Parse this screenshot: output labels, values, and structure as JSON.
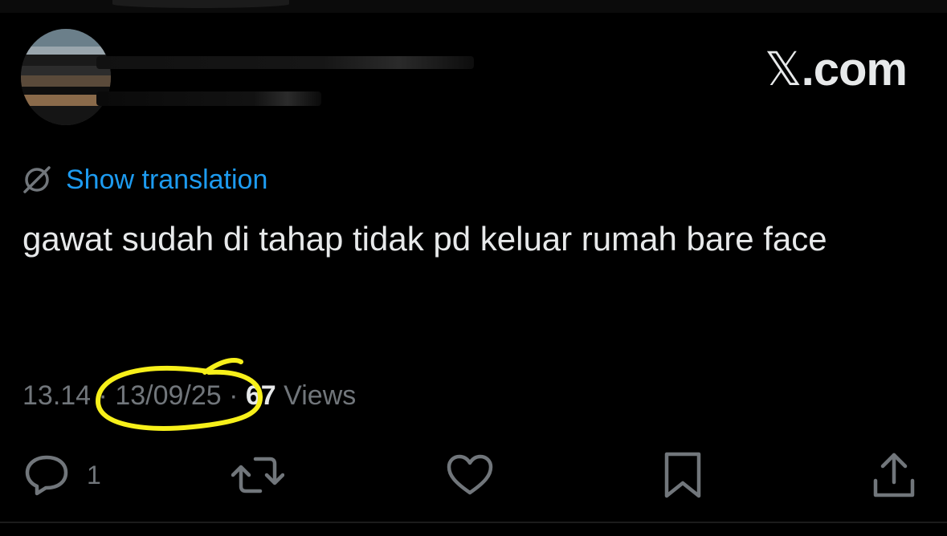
{
  "brand": {
    "logo_text": ".com",
    "logo_x": "𝕏"
  },
  "tweet": {
    "translate_label": "Show translation",
    "text": "gawat sudah di tahap tidak pd keluar rumah bare face",
    "time": "13.14",
    "separator": " · ",
    "date": "13/09/25",
    "views_count": "67",
    "views_label": " Views"
  },
  "actions": {
    "reply_count": "1"
  },
  "icons": {
    "translate": "globe-slash-icon",
    "reply": "reply-icon",
    "retweet": "retweet-icon",
    "like": "heart-icon",
    "bookmark": "bookmark-icon",
    "share": "share-icon"
  },
  "colors": {
    "background": "#000000",
    "text": "#e7e9ea",
    "muted": "#71767b",
    "link": "#1d9bf0",
    "highlight": "#f7f01a"
  }
}
